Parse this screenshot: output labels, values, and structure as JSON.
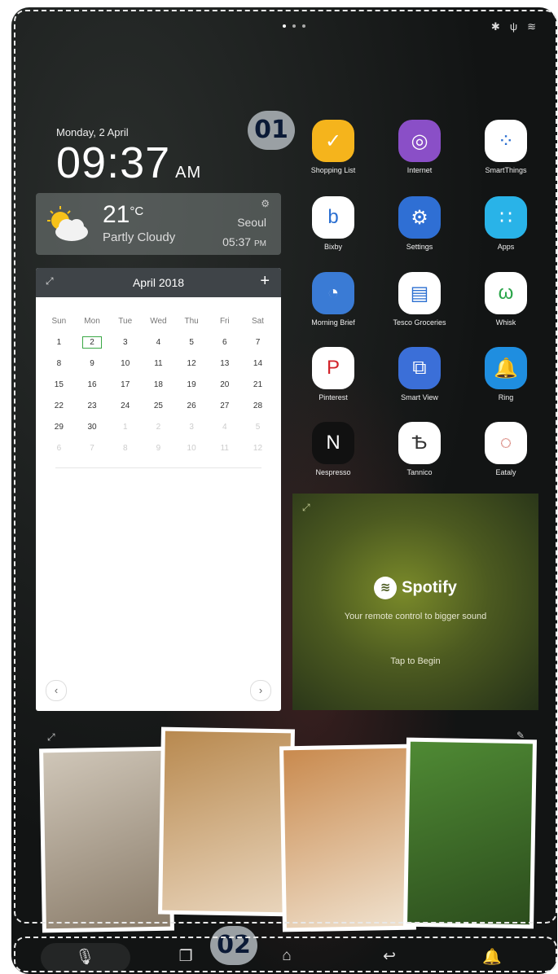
{
  "markers": {
    "region1": "01",
    "region2": "02"
  },
  "clock": {
    "date": "Monday, 2 April",
    "time": "09:37",
    "ampm": "AM"
  },
  "weather": {
    "temp": "21",
    "unit": "°C",
    "condition": "Partly Cloudy",
    "city": "Seoul",
    "time": "05:37",
    "ampm": "PM",
    "icon": "partly-cloudy-icon"
  },
  "calendar": {
    "month": "April 2018",
    "weekdays": [
      "Sun",
      "Mon",
      "Tue",
      "Wed",
      "Thu",
      "Fri",
      "Sat"
    ],
    "weeks": [
      [
        "1",
        "2",
        "3",
        "4",
        "5",
        "6",
        "7"
      ],
      [
        "8",
        "9",
        "10",
        "11",
        "12",
        "13",
        "14"
      ],
      [
        "15",
        "16",
        "17",
        "18",
        "19",
        "20",
        "21"
      ],
      [
        "22",
        "23",
        "24",
        "25",
        "26",
        "27",
        "28"
      ],
      [
        "29",
        "30",
        "1",
        "2",
        "3",
        "4",
        "5"
      ],
      [
        "6",
        "7",
        "8",
        "9",
        "10",
        "11",
        "12"
      ]
    ],
    "today": "2",
    "prev": "‹",
    "next": "›",
    "add": "+"
  },
  "apps": [
    {
      "label": "Shopping List",
      "icon": "shopping-list-icon",
      "color": "#f5b41c",
      "glyph": "✓"
    },
    {
      "label": "Internet",
      "icon": "internet-icon",
      "color": "#8a4fc7",
      "glyph": "◎"
    },
    {
      "label": "SmartThings",
      "icon": "smartthings-icon",
      "color": "#ffffff",
      "glyph": "⁘"
    },
    {
      "label": "Bixby",
      "icon": "bixby-icon",
      "color": "#ffffff",
      "glyph": "b"
    },
    {
      "label": "Settings",
      "icon": "settings-icon",
      "color": "#2f6fd4",
      "glyph": "⚙"
    },
    {
      "label": "Apps",
      "icon": "apps-icon",
      "color": "#29b3e8",
      "glyph": "∷"
    },
    {
      "label": "Morning Brief",
      "icon": "morning-brief-icon",
      "color": "#3a7bd5",
      "glyph": "◔"
    },
    {
      "label": "Tesco Groceries",
      "icon": "tesco-groceries-icon",
      "color": "#ffffff",
      "glyph": "▤"
    },
    {
      "label": "Whisk",
      "icon": "whisk-icon",
      "color": "#ffffff",
      "glyph": "ω"
    },
    {
      "label": "Pinterest",
      "icon": "pinterest-icon",
      "color": "#ffffff",
      "glyph": "P"
    },
    {
      "label": "Smart View",
      "icon": "smart-view-icon",
      "color": "#3b6fd8",
      "glyph": "⧉"
    },
    {
      "label": "Ring",
      "icon": "ring-icon",
      "color": "#1f8ee0",
      "glyph": "🔔"
    },
    {
      "label": "Nespresso",
      "icon": "nespresso-icon",
      "color": "#111111",
      "glyph": "N"
    },
    {
      "label": "Tannico",
      "icon": "tannico-icon",
      "color": "#ffffff",
      "glyph": "Ѣ"
    },
    {
      "label": "Eataly",
      "icon": "eataly-icon",
      "color": "#ffffff",
      "glyph": "◌"
    }
  ],
  "spotify": {
    "brand": "Spotify",
    "tagline": "Your remote control to bigger sound",
    "action": "Tap to Begin"
  },
  "photos": [
    {
      "name": "photo-cat-bedroom",
      "colors": [
        "#cfc6b8",
        "#8a7c6a"
      ]
    },
    {
      "name": "photo-family-portrait",
      "colors": [
        "#b8894f",
        "#e9d5bc"
      ]
    },
    {
      "name": "photo-family-breakfast",
      "colors": [
        "#c98a4e",
        "#f0e2cf"
      ]
    },
    {
      "name": "photo-dog-garden",
      "colors": [
        "#4f8a34",
        "#2c4d1d"
      ]
    }
  ],
  "navbar": {
    "mic": "🎙",
    "recents": "❐",
    "home": "⌂",
    "back": "↩",
    "notifications": "🔔"
  }
}
